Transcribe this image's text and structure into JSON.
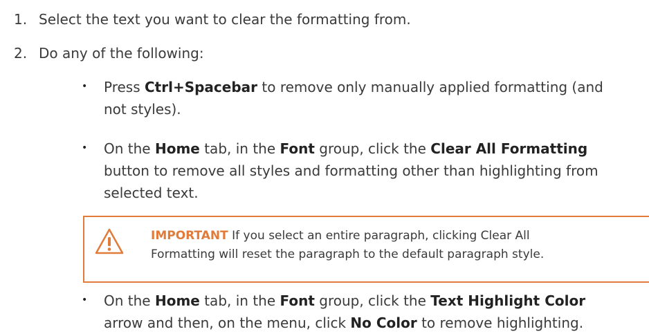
{
  "steps": [
    {
      "number": "1.",
      "text": "Select the text you want to clear the formatting from."
    },
    {
      "number": "2.",
      "text": "Do any of the following:"
    }
  ],
  "bullet_glyph": "•",
  "bullets": [
    {
      "lines": [
        [
          {
            "t": "Press "
          },
          {
            "t": "Ctrl+Spacebar",
            "b": true
          },
          {
            "t": " to remove only manually applied formatting (and"
          }
        ],
        [
          {
            "t": "not styles)."
          }
        ]
      ]
    },
    {
      "lines": [
        [
          {
            "t": "On the "
          },
          {
            "t": "Home",
            "b": true
          },
          {
            "t": " tab, in the "
          },
          {
            "t": "Font",
            "b": true
          },
          {
            "t": " group, click the "
          },
          {
            "t": "Clear All Formatting",
            "b": true
          }
        ],
        [
          {
            "t": "button to remove all styles and formatting other than highlighting from"
          }
        ],
        [
          {
            "t": "selected text."
          }
        ]
      ]
    },
    {
      "lines": [
        [
          {
            "t": "On the "
          },
          {
            "t": "Home",
            "b": true
          },
          {
            "t": " tab, in the "
          },
          {
            "t": "Font",
            "b": true
          },
          {
            "t": " group, click the "
          },
          {
            "t": "Text Highlight Color",
            "b": true
          }
        ],
        [
          {
            "t": "arrow and then, on the menu, click "
          },
          {
            "t": "No Color",
            "b": true
          },
          {
            "t": " to remove highlighting."
          }
        ]
      ]
    }
  ],
  "callout": {
    "label": "IMPORTANT",
    "line1": " If you select an entire paragraph, clicking Clear All",
    "line2": "Formatting will reset the paragraph to the default paragraph style.",
    "accent": "#e07b3a",
    "icon": "warning-icon"
  }
}
